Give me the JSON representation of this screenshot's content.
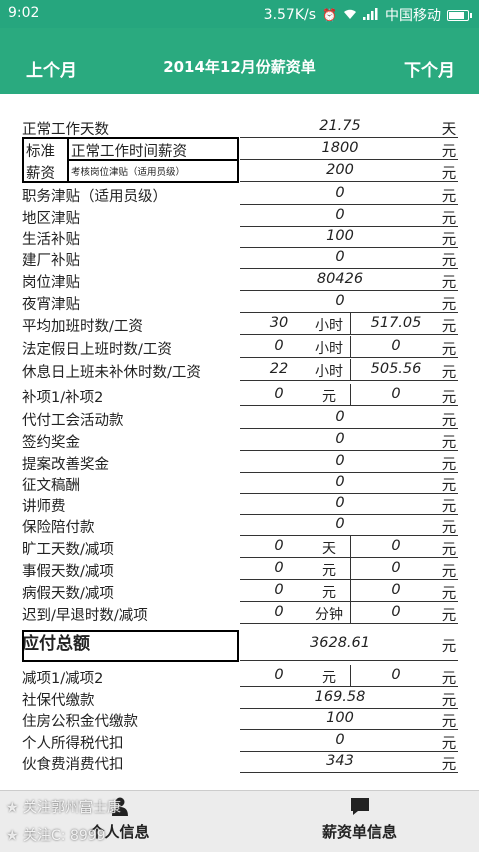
{
  "status_bar": {
    "time": "9:02",
    "speed": "3.57K/s",
    "carrier": "中国移动"
  },
  "header": {
    "prev_label": "上个月",
    "title": "2014年12月份薪资单",
    "next_label": "下个月"
  },
  "standard": {
    "group_label_1": "标准",
    "group_label_2": "薪资"
  },
  "rows": [
    {
      "label": "正常工作天数",
      "value": "21.75",
      "unit": "天"
    },
    {
      "label": "正常工作时间薪资",
      "value": "1800",
      "unit": "元"
    },
    {
      "label": "考核岗位津贴（适用员级）",
      "value": "200",
      "unit": "元"
    },
    {
      "label": "职务津贴（适用员级）",
      "value": "0",
      "unit": "元"
    },
    {
      "label": "地区津贴",
      "value": "0",
      "unit": "元"
    },
    {
      "label": "生活补贴",
      "value": "100",
      "unit": "元"
    },
    {
      "label": "建厂补贴",
      "value": "0",
      "unit": "元"
    },
    {
      "label": "岗位津贴",
      "value": "80426",
      "unit": "元"
    },
    {
      "label": "夜宵津贴",
      "value": "0",
      "unit": "元"
    },
    {
      "label": "平均加班时数/工资",
      "qty": "30",
      "mid": "小时",
      "value": "517.05",
      "unit": "元"
    },
    {
      "label": "法定假日上班时数/工资",
      "qty": "0",
      "mid": "小时",
      "value": "0",
      "unit": "元"
    },
    {
      "label": "休息日上班未补休时数/工资",
      "qty": "22",
      "mid": "小时",
      "value": "505.56",
      "unit": "元"
    },
    {
      "label": "补项1/补项2",
      "qty": "0",
      "mid": "元",
      "value": "0",
      "unit": "元"
    },
    {
      "label": "代付工会活动款",
      "value": "0",
      "unit": "元"
    },
    {
      "label": "签约奖金",
      "value": "0",
      "unit": "元"
    },
    {
      "label": "提案改善奖金",
      "value": "0",
      "unit": "元"
    },
    {
      "label": "征文稿酬",
      "value": "0",
      "unit": "元"
    },
    {
      "label": "讲师费",
      "value": "0",
      "unit": "元"
    },
    {
      "label": "保险陪付款",
      "value": "0",
      "unit": "元"
    },
    {
      "label": "旷工天数/减项",
      "qty": "0",
      "mid": "天",
      "value": "0",
      "unit": "元"
    },
    {
      "label": "事假天数/减项",
      "qty": "0",
      "mid": "元",
      "value": "0",
      "unit": "元"
    },
    {
      "label": "病假天数/减项",
      "qty": "0",
      "mid": "元",
      "value": "0",
      "unit": "元"
    },
    {
      "label": "迟到/早退时数/减项",
      "qty": "0",
      "mid": "分钟",
      "value": "0",
      "unit": "元"
    },
    {
      "label": "应付总额",
      "value": "3628.61",
      "unit": "元"
    },
    {
      "label": "减项1/减项2",
      "qty": "0",
      "mid": "元",
      "value": "0",
      "unit": "元"
    },
    {
      "label": "社保代缴款",
      "value": "169.58",
      "unit": "元"
    },
    {
      "label": "住房公积金代缴款",
      "value": "100",
      "unit": "元"
    },
    {
      "label": "个人所得税代扣",
      "value": "0",
      "unit": "元"
    },
    {
      "label": "伙食费消费代扣",
      "value": "343",
      "unit": "元"
    }
  ],
  "bottom_nav": {
    "tab_personal": "个人信息",
    "tab_payslip": "薪资单信息"
  },
  "watermark": {
    "line1": "★ 关注郭州富士康",
    "line2": "★ 关注C:  8999"
  },
  "colors": {
    "accent": "#2aaa7f",
    "statusbar": "#26a67e"
  }
}
